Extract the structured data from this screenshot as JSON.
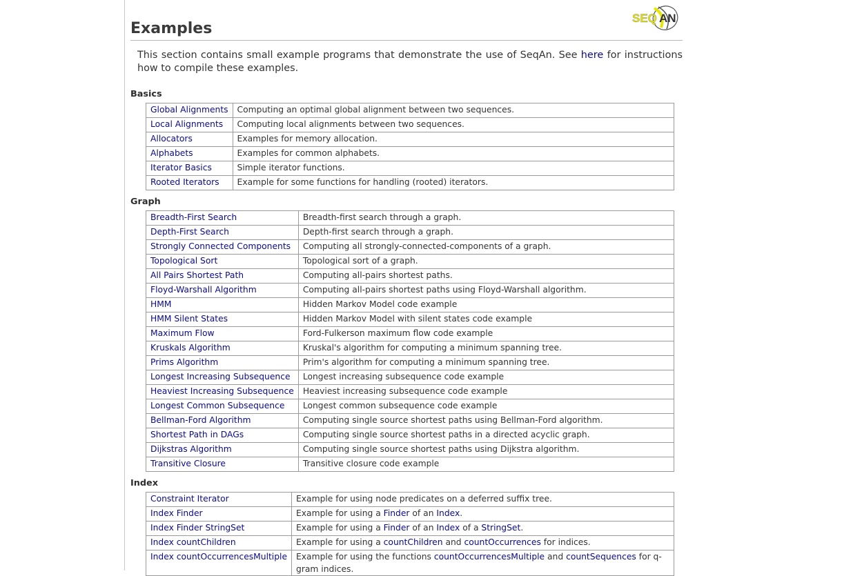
{
  "page": {
    "title": "Examples",
    "logo_text": "SEQAN"
  },
  "intro": {
    "before": "This section contains small example programs that demonstrate the use of SeqAn. See ",
    "link": "here",
    "after": " for instructions how to compile these examples."
  },
  "sections": {
    "basics": {
      "title": "Basics",
      "rows": [
        {
          "name": "Global Alignments",
          "desc": "Computing an optimal global alignment between two sequences."
        },
        {
          "name": "Local Alignments",
          "desc": "Computing local alignments between two sequences."
        },
        {
          "name": "Allocators",
          "desc": "Examples for memory allocation."
        },
        {
          "name": "Alphabets",
          "desc": "Examples for common alphabets."
        },
        {
          "name": "Iterator Basics",
          "desc": "Simple iterator functions."
        },
        {
          "name": "Rooted Iterators",
          "desc": "Example for some functions for handling (rooted) iterators."
        }
      ]
    },
    "graph": {
      "title": "Graph",
      "rows": [
        {
          "name": "Breadth-First Search",
          "desc": "Breadth-first search through a graph."
        },
        {
          "name": "Depth-First Search",
          "desc": "Depth-first search through a graph."
        },
        {
          "name": "Strongly Connected Components",
          "desc": "Computing all strongly-connected-components of a graph."
        },
        {
          "name": "Topological Sort",
          "desc": "Topological sort of a graph."
        },
        {
          "name": "All Pairs Shortest Path",
          "desc": "Computing all-pairs shortest paths."
        },
        {
          "name": "Floyd-Warshall Algorithm",
          "desc": "Computing all-pairs shortest paths using Floyd-Warshall algorithm."
        },
        {
          "name": "HMM",
          "desc": "Hidden Markov Model code example"
        },
        {
          "name": "HMM Silent States",
          "desc": "Hidden Markov Model with silent states code example"
        },
        {
          "name": "Maximum Flow",
          "desc": "Ford-Fulkerson maximum flow code example"
        },
        {
          "name": "Kruskals Algorithm",
          "desc": "Kruskal's algorithm for computing a minimum spanning tree."
        },
        {
          "name": "Prims Algorithm",
          "desc": "Prim's algorithm for computing a minimum spanning tree."
        },
        {
          "name": "Longest Increasing Subsequence",
          "desc": "Longest increasing subsequence code example"
        },
        {
          "name": "Heaviest Increasing Subsequence",
          "desc": "Heaviest increasing subsequence code example"
        },
        {
          "name": "Longest Common Subsequence",
          "desc": "Longest common subsequence code example"
        },
        {
          "name": "Bellman-Ford Algorithm",
          "desc": "Computing single source shortest paths using Bellman-Ford algorithm."
        },
        {
          "name": "Shortest Path in DAGs",
          "desc": "Computing single source shortest paths in a directed acyclic graph."
        },
        {
          "name": "Dijkstras Algorithm",
          "desc": "Computing single source shortest paths using Dijkstra algorithm."
        },
        {
          "name": "Transitive Closure",
          "desc": "Transitive closure code example"
        }
      ]
    },
    "index": {
      "title": "Index",
      "rows": [
        {
          "name": "Constraint Iterator",
          "desc": [
            {
              "t": "Example for using node predicates on a deferred suffix tree."
            }
          ]
        },
        {
          "name": "Index Finder",
          "desc": [
            {
              "t": "Example for using a "
            },
            {
              "t": "Finder",
              "link": true
            },
            {
              "t": " of an "
            },
            {
              "t": "Index",
              "link": true
            },
            {
              "t": "."
            }
          ]
        },
        {
          "name": "Index Finder StringSet",
          "desc": [
            {
              "t": "Example for using a "
            },
            {
              "t": "Finder",
              "link": true
            },
            {
              "t": " of an "
            },
            {
              "t": "Index",
              "link": true
            },
            {
              "t": " of a "
            },
            {
              "t": "StringSet",
              "link": true
            },
            {
              "t": "."
            }
          ]
        },
        {
          "name": "Index countChildren",
          "desc": [
            {
              "t": "Example for using a "
            },
            {
              "t": "countChildren",
              "link": true
            },
            {
              "t": " and "
            },
            {
              "t": "countOccurrences",
              "link": true
            },
            {
              "t": " for indices."
            }
          ]
        },
        {
          "name": "Index countOccurrencesMultiple",
          "desc": [
            {
              "t": "Example for using the functions "
            },
            {
              "t": "countOccurrencesMultiple",
              "link": true
            },
            {
              "t": " and "
            },
            {
              "t": "countSequences",
              "link": true
            },
            {
              "t": " for q-gram indices."
            }
          ]
        }
      ]
    }
  },
  "colors": {
    "link": "#0b0b8c",
    "logo_yellow": "#e6e600",
    "text": "#333333",
    "border": "#9a9a9a"
  }
}
